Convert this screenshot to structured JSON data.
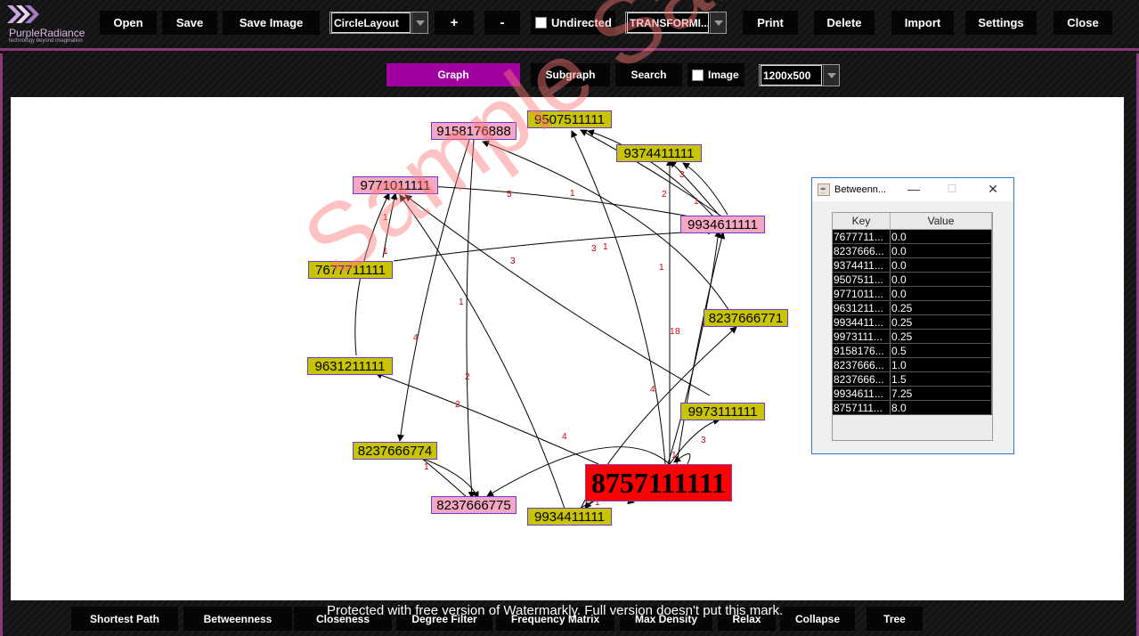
{
  "app": {
    "logo_name": "PurpleRadiance",
    "logo_tagline": "technology beyond imagination"
  },
  "toolbar": {
    "open": "Open",
    "save": "Save",
    "save_image": "Save Image",
    "layout_value": "CircleLayout",
    "plus": "+",
    "minus": "-",
    "undirected": "Undirected",
    "mode_value": "TRANSFORMI...",
    "print": "Print",
    "delete": "Delete",
    "import": "Import",
    "settings": "Settings",
    "close": "Close"
  },
  "subbar": {
    "graph": "Graph",
    "subgraph": "Subgraph",
    "search": "Search",
    "image": "Image",
    "size_value": "1200x500"
  },
  "graph": {
    "nodes": {
      "n9507": "9507511111",
      "n9158": "9158176888",
      "n9374": "9374411111",
      "n9771": "9771011111",
      "n9934a": "9934611111",
      "n7677": "7677711111",
      "n8237a": "8237666771",
      "n9631": "9631211111",
      "n9973": "9973111111",
      "n8237b": "8237666774",
      "n8757": "8757111111",
      "n8237c": "8237666775",
      "n9934b": "9934411111"
    },
    "edge_labels": {
      "e1": "5",
      "e2": "1",
      "e3": "2",
      "e4": "3",
      "e5": "1",
      "e6": "3",
      "e7": "1",
      "e8": "1",
      "e9": "3",
      "e10": "4",
      "e11": "1",
      "e12": "2",
      "e13": "1",
      "e14": "4",
      "e15": "2",
      "e16": "4",
      "e17": "3",
      "e18": "1",
      "e19": "1",
      "e20": "1",
      "e21": "8",
      "e22": "1",
      "e23": "1"
    }
  },
  "watermark": "Sample Sample",
  "protect_notice": "Protected with free version of Watermarkly. Full version doesn't put this mark.",
  "dialog": {
    "title": "Betweenn...",
    "col_key": "Key",
    "col_value": "Value",
    "rows": [
      {
        "key": "7677711...",
        "value": "0.0"
      },
      {
        "key": "8237666...",
        "value": "0.0"
      },
      {
        "key": "9374411...",
        "value": "0.0"
      },
      {
        "key": "9507511...",
        "value": "0.0"
      },
      {
        "key": "9771011...",
        "value": "0.0"
      },
      {
        "key": "9631211...",
        "value": "0.25"
      },
      {
        "key": "9934411...",
        "value": "0.25"
      },
      {
        "key": "9973111...",
        "value": "0.25"
      },
      {
        "key": "9158176...",
        "value": "0.5"
      },
      {
        "key": "8237666...",
        "value": "1.0"
      },
      {
        "key": "8237666...",
        "value": "1.5"
      },
      {
        "key": "9934611...",
        "value": "7.25"
      },
      {
        "key": "8757111...",
        "value": "8.0"
      }
    ]
  },
  "bottom": {
    "shortest_path": "Shortest Path",
    "betweenness": "Betweenness",
    "closeness": "Closeness",
    "degree_filter": "Degree Filter",
    "frequency_matrix": "Frequency Matrix",
    "max_density": "Max Density",
    "relax": "Relax",
    "collapse": "Collapse",
    "tree": "Tree"
  },
  "colors": {
    "accent": "#a000a0",
    "frame": "#8a3a7a",
    "node_yellow": "#c8c400",
    "node_pink": "#f4a8c0",
    "node_red": "#ff0000",
    "edge_label": "#d40000"
  }
}
